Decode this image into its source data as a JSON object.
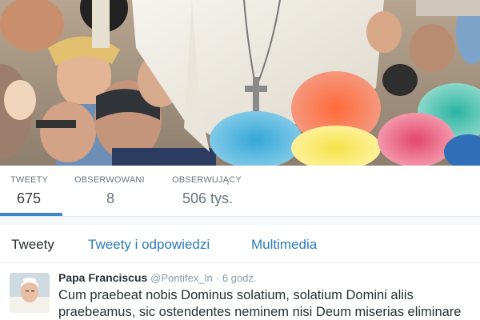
{
  "colors": {
    "accent": "#3b88c3",
    "link": "#2b7bb9",
    "muted_text": "#66757f",
    "border": "#e1e8ed"
  },
  "profile_nav": {
    "stats": [
      {
        "label": "TWEETY",
        "value": "675",
        "active": true
      },
      {
        "label": "OBSERWOWANI",
        "value": "8",
        "active": false
      },
      {
        "label": "OBSERWUJĄCY",
        "value": "506 tys.",
        "active": false
      }
    ]
  },
  "timeline_tabs": [
    {
      "label": "Tweety",
      "active": true
    },
    {
      "label": "Tweety i odpowiedzi",
      "active": false
    },
    {
      "label": "Multimedia",
      "active": false
    }
  ],
  "tweet": {
    "name": "Papa Franciscus",
    "handle": "@Pontifex_ln",
    "separator": "·",
    "time": "6 godz.",
    "text": "Cum praebeat nobis Dominus solatium, solatium Domini aliis praebeamus, sic ostendentes neminem nisi Deum miserias eliminare"
  }
}
